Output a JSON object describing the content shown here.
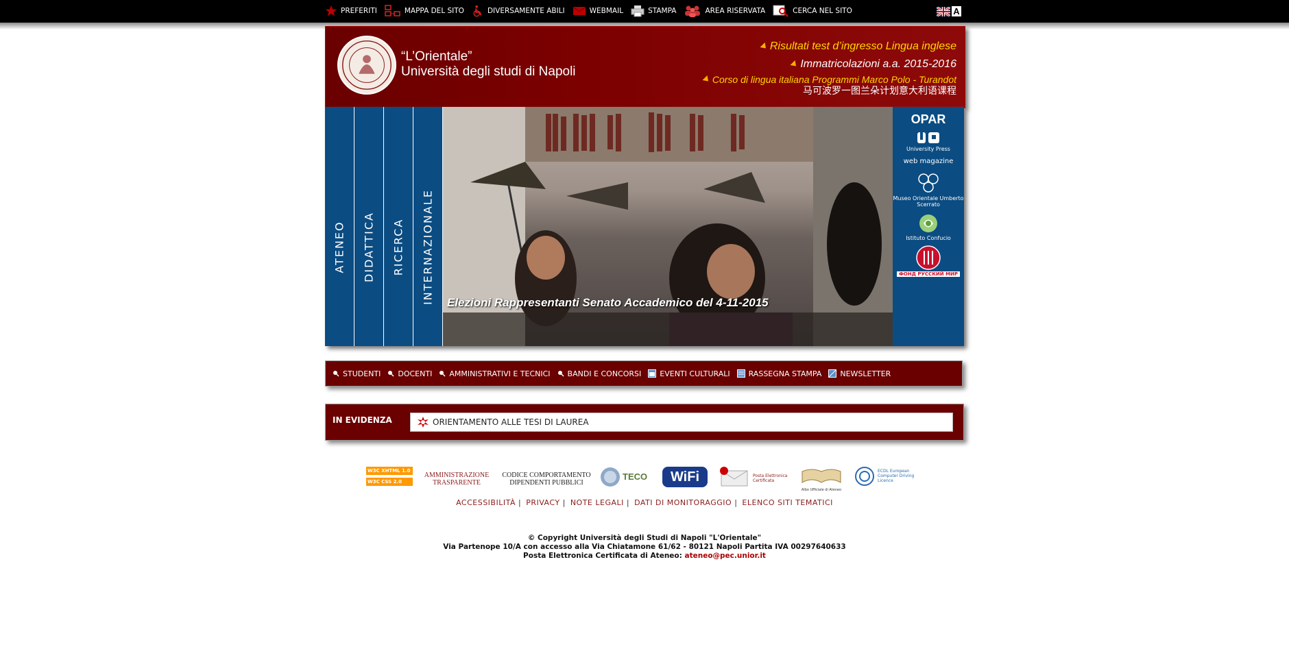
{
  "toplinks": [
    {
      "label": "PREFERITI",
      "icon": "star-icon"
    },
    {
      "label": "MAPPA DEL SITO",
      "icon": "sitemap-icon"
    },
    {
      "label": "DIVERSAMENTE ABILI",
      "icon": "wheelchair-icon"
    },
    {
      "label": "WEBMAIL",
      "icon": "mail-icon"
    },
    {
      "label": "STAMPA",
      "icon": "printer-icon"
    },
    {
      "label": "AREA RISERVATA",
      "icon": "users-icon"
    },
    {
      "label": "CERCA NEL SITO",
      "icon": "search-icon"
    }
  ],
  "accessibility_letter": "A",
  "header": {
    "name_line1": "“L’Orientale”",
    "name_line2": "Università degli studi di Napoli",
    "news": [
      "Risultati test d’ingresso Lingua inglese",
      "Immatricolazioni a.a. 2015-2016",
      "Corso di lingua italiana Programmi Marco Polo - Turandot"
    ],
    "news_chinese": "马可波罗一图兰朵计划意大利语课程"
  },
  "vertical_tabs": [
    "ATENEO",
    "DIDATTICA",
    "RICERCA",
    "INTERNAZIONALE"
  ],
  "banner_caption": "Elezioni Rappresentanti Senato Accademico del 4-11-2015",
  "side_portal": {
    "title": "OPAR",
    "items": [
      "University Press",
      "web magazine",
      "Museo Orientale Umberto Scerrato",
      "Istituto Confucio",
      "ФОНД РУССКИЙ МИР"
    ]
  },
  "menu": [
    "STUDENTI",
    "DOCENTI",
    "AMMINISTRATIVI E TECNICI",
    "BANDI E CONCORSI",
    "EVENTI CULTURALI",
    "RASSEGNA STAMPA",
    "NEWSLETTER"
  ],
  "in_evidenza": {
    "label": "IN EVIDENZA",
    "item": "ORIENTAMENTO ALLE TESI DI LAUREA"
  },
  "badges": {
    "w3c_xhtml": "W3C XHTML 1.0",
    "w3c_css": "W3C CSS 2.0",
    "amministrazione": "AMMINISTRAZIONE TRASPARENTE",
    "codice": "CODICE COMPORTAMENTO DIPENDENTI PUBBLICI",
    "teco": "TECO",
    "wifi": "WiFi",
    "pec": "Posta Elettronica Certificata",
    "albo": "Albo Ufficiale di Ateneo",
    "ecdl": "ECDL European Computer Driving Licence"
  },
  "footer_links": [
    "ACCESSIBILITÀ",
    "PRIVACY",
    "NOTE LEGALI",
    "DATI DI MONITORAGGIO",
    "ELENCO SITI TEMATICI"
  ],
  "copyright": {
    "line1": "© Copyright Università degli Studi di Napoli \"L'Orientale\"",
    "line2": "Via Partenope 10/A con accesso alla Via Chiatamone 61/62 - 80121 Napoli Partita IVA 00297640633",
    "line3_prefix": "Posta Elettronica Certificata di Ateneo:",
    "email": "ateneo@pec.unior.it"
  },
  "colors": {
    "header_red": "#7c0000",
    "nav_blue": "#0b4c82",
    "news_yellow": "#ffd500",
    "link_red": "#8b1a1a"
  }
}
